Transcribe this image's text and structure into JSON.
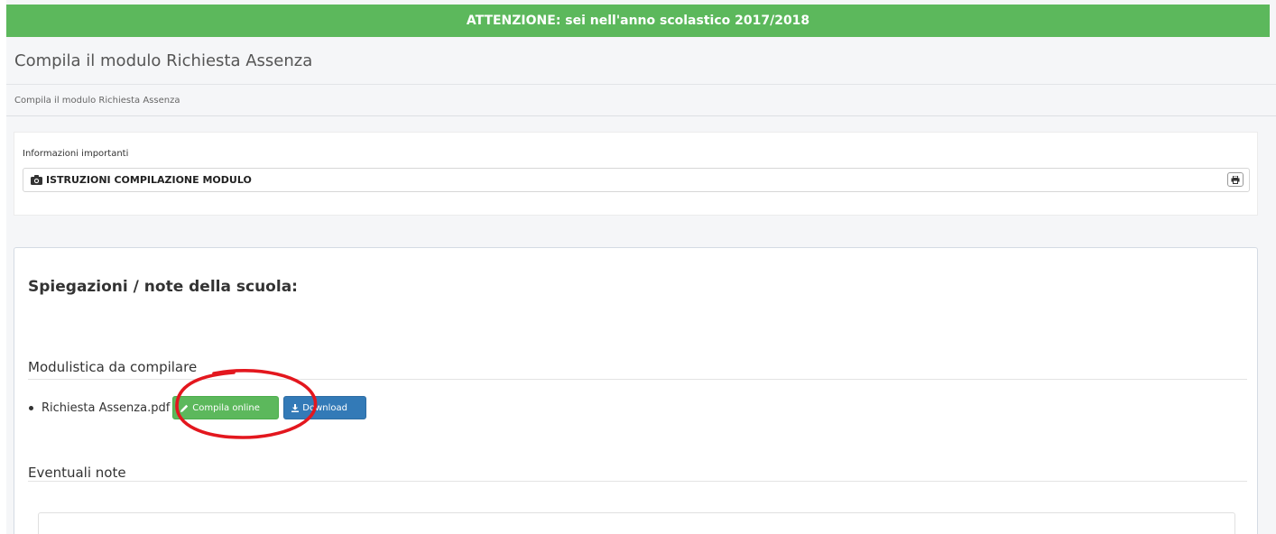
{
  "banner": {
    "text": "ATTENZIONE: sei nell'anno scolastico 2017/2018",
    "color": "#5cb85c"
  },
  "header": {
    "title": "Compila il modulo Richiesta Assenza"
  },
  "breadcrumb": {
    "text": "Compila il modulo Richiesta Assenza"
  },
  "info": {
    "label": "Informazioni importanti",
    "instructions_title": "ISTRUZIONI COMPILAZIONE MODULO",
    "instructions_icon": "camera-icon",
    "print_icon": "print-icon"
  },
  "main": {
    "school_title": "Spiegazioni / note della scuola:",
    "forms_heading": "Modulistica da compilare",
    "files": [
      {
        "name": "Richiesta Assenza.pdf",
        "compile_label": "Compila online",
        "compile_icon": "pencil-icon",
        "download_label": "Download",
        "download_icon": "download-icon"
      }
    ],
    "notes_heading": "Eventuali note"
  },
  "colors": {
    "success": "#5cb85c",
    "primary": "#337ab7",
    "annotation": "#e3171e"
  }
}
